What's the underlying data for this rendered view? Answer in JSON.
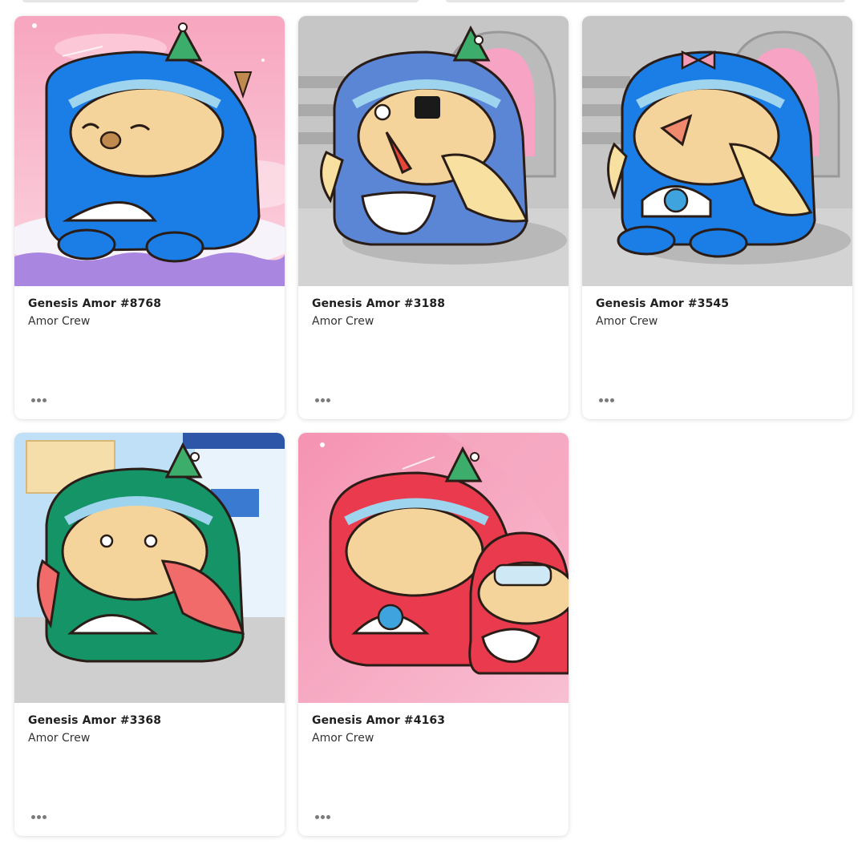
{
  "collection_label": "Amor Crew",
  "more_icon": "ellipsis-horizontal-icon",
  "cards": [
    {
      "title": "Genesis Amor #8768",
      "subtitle": "Amor Crew",
      "scene": "pink-sky",
      "body_color": "#1b7ee6",
      "hat": "party-hat"
    },
    {
      "title": "Genesis Amor #3188",
      "subtitle": "Amor Crew",
      "scene": "space-station",
      "body_color": "#5b86d6",
      "hat": "party-hat"
    },
    {
      "title": "Genesis Amor #3545",
      "subtitle": "Amor Crew",
      "scene": "space-station",
      "body_color": "#1b7ee6",
      "hat": "pink-bow"
    },
    {
      "title": "Genesis Amor #3368",
      "subtitle": "Amor Crew",
      "scene": "laboratory",
      "body_color": "#159467",
      "hat": "party-hat"
    },
    {
      "title": "Genesis Amor #4163",
      "subtitle": "Amor Crew",
      "scene": "pink-space",
      "body_color": "#ea3b4e",
      "hat": "party-hat"
    }
  ]
}
